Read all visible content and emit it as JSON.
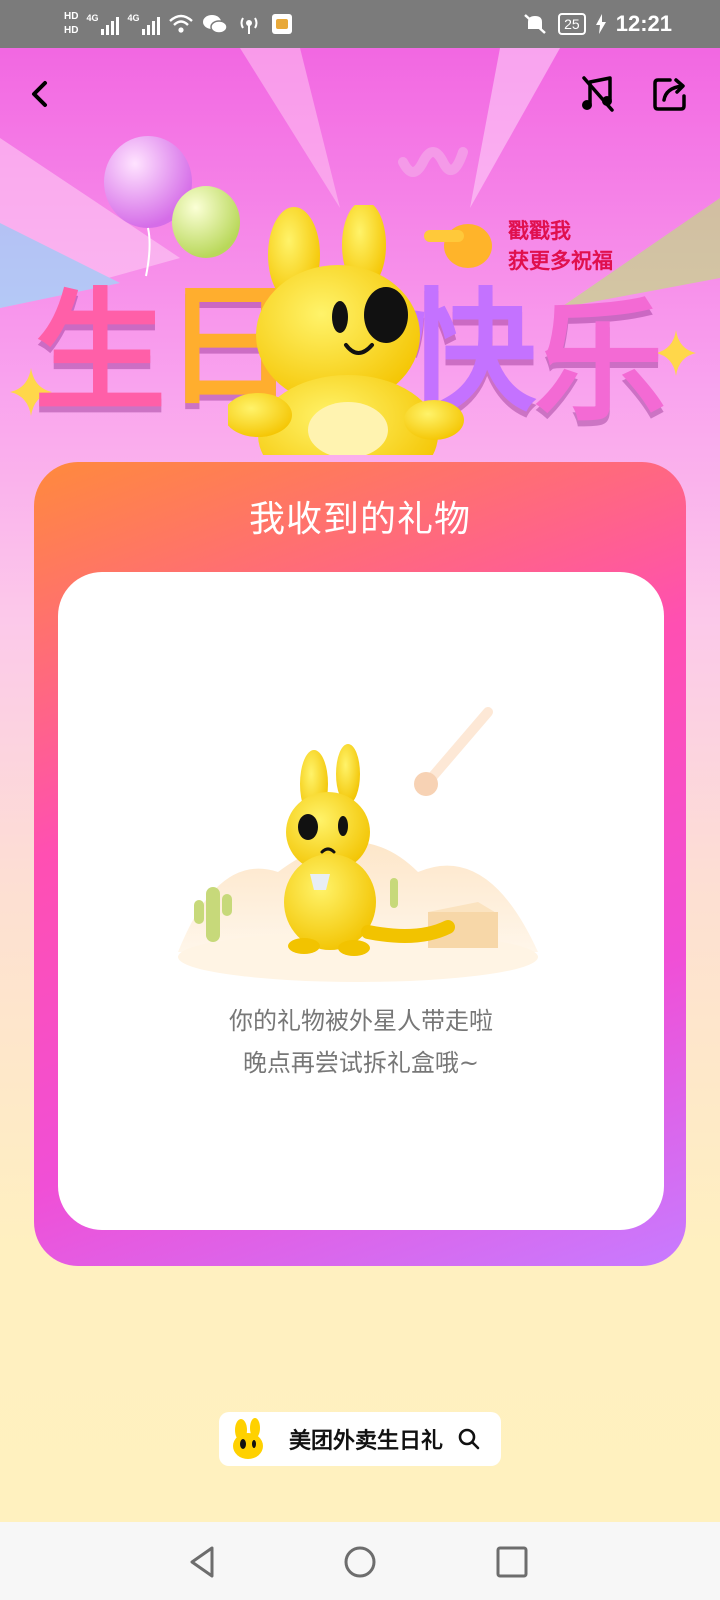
{
  "status_bar": {
    "hd1": "HD",
    "hd2": "HD",
    "net1": "4G",
    "net2": "4G",
    "battery": "25",
    "time": "12:21"
  },
  "nav": {
    "back_icon": "back-arrow-icon",
    "music_icon": "music-off-icon",
    "share_icon": "share-icon"
  },
  "hero": {
    "title_chars": [
      "生",
      "日",
      "快",
      "乐"
    ],
    "tip_line1": "戳戳我",
    "tip_line2": "获更多祝福"
  },
  "gift_card": {
    "title": "我收到的礼物",
    "empty_line1": "你的礼物被外星人带走啦",
    "empty_line2": "晚点再尝试拆礼盒哦~"
  },
  "brand": {
    "label": "美团外卖生日礼",
    "search_icon": "search-icon"
  },
  "colors": {
    "accent_pink": "#ff4fb2",
    "accent_orange": "#ff8a3c",
    "tip_red": "#e0104e",
    "bg_cream": "#fff1bf"
  }
}
